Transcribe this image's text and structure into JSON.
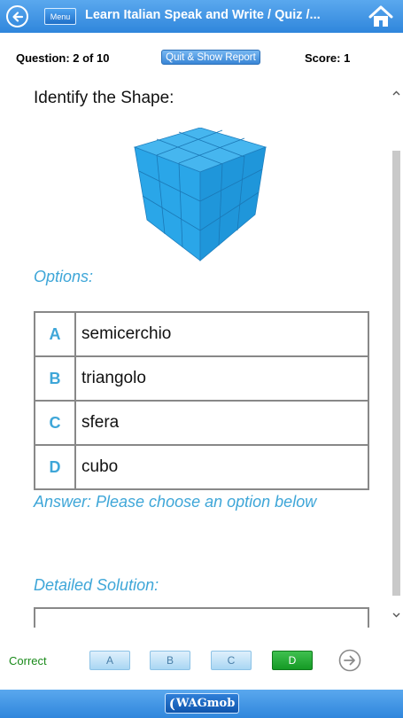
{
  "header": {
    "back_icon": "back-arrow-circle-icon",
    "menu_label": "Menu",
    "title": "Learn Italian Speak and Write / Quiz /...",
    "home_icon": "home-icon"
  },
  "status": {
    "question": "Question: 2  of 10",
    "quit_label": "Quit & Show Report",
    "score": "Score: 1"
  },
  "question": {
    "prompt": "Identify the Shape:",
    "image": "blue-cube-image"
  },
  "options": {
    "heading": "Options:",
    "items": [
      {
        "letter": "A",
        "text": "semicerchio"
      },
      {
        "letter": "B",
        "text": "triangolo"
      },
      {
        "letter": "C",
        "text": "sfera"
      },
      {
        "letter": "D",
        "text": "cubo"
      }
    ]
  },
  "answer_text": "Answer: Please choose an option below",
  "solution_heading": "Detailed Solution:",
  "answer_bar": {
    "result": "Correct",
    "buttons": [
      "A",
      "B",
      "C",
      "D"
    ],
    "selected": "D",
    "next_icon": "next-arrow-circle-icon"
  },
  "footer": {
    "brand_mark": "(",
    "brand": "WAGmob"
  },
  "colors": {
    "header_blue": "#2f86dc",
    "accent_text": "#3ea6d8",
    "cube_blue": "#27a4e6",
    "selected_green": "#1ea82e",
    "correct_text": "#1a8a1a"
  }
}
